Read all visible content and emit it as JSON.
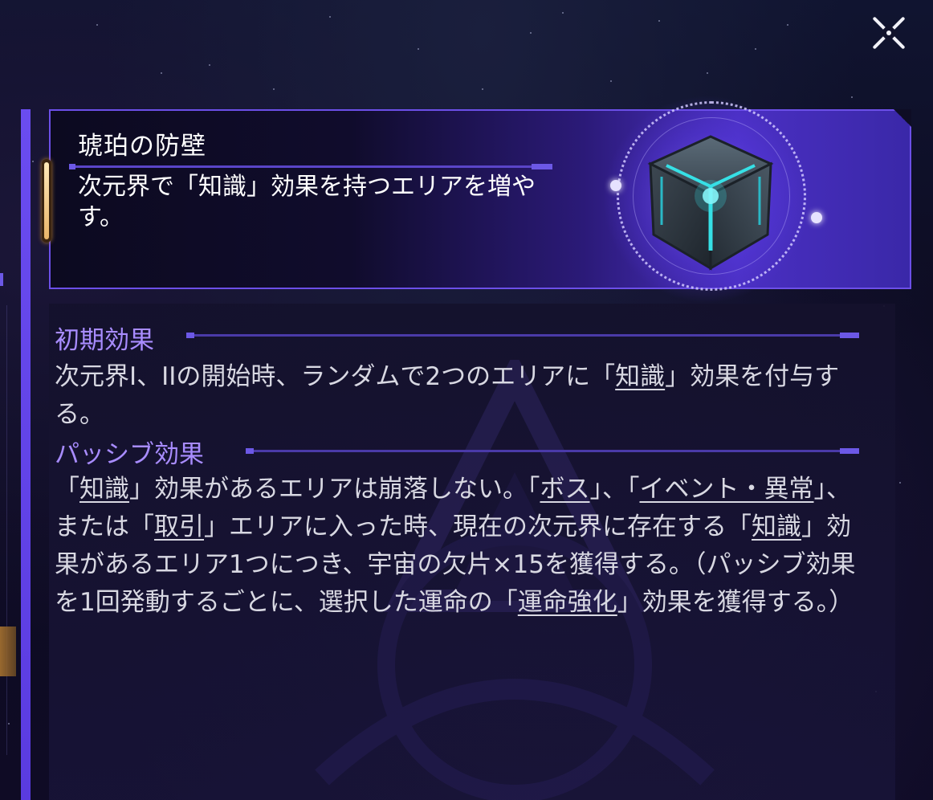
{
  "relic": {
    "name": "琥珀の防壁",
    "description": "次元界で「知識」効果を持つエリアを増やす。",
    "icon": "cube-relic-icon",
    "accent_color": "#6c4fe8",
    "glow_color": "#36e0e6"
  },
  "close_button": {
    "icon": "close-icon"
  },
  "sections": [
    {
      "title": "初期効果",
      "segments": [
        {
          "text": "次元界I、IIの開始時、ランダムで2つのエリアに「"
        },
        {
          "text": "知識",
          "keyword": true
        },
        {
          "text": "」効果を付与する。"
        }
      ]
    },
    {
      "title": "パッシブ効果",
      "segments": [
        {
          "text": "「"
        },
        {
          "text": "知識",
          "keyword": true
        },
        {
          "text": "」効果があるエリアは崩落しない。「"
        },
        {
          "text": "ボス",
          "keyword": true
        },
        {
          "text": "」、「"
        },
        {
          "text": "イベント・異常",
          "keyword": true
        },
        {
          "text": "」、または「"
        },
        {
          "text": "取引",
          "keyword": true
        },
        {
          "text": "」エリアに入った時、現在の次元界に存在する「"
        },
        {
          "text": "知識",
          "keyword": true
        },
        {
          "text": "」効果があるエリア1つにつき、宇宙の欠片×15を獲得する。（パッシブ効果を1回発動するごとに、選択した運命の「"
        },
        {
          "text": "運命強化",
          "keyword": true
        },
        {
          "text": "」効果を獲得する。）"
        }
      ]
    }
  ],
  "colors": {
    "section_title": "#a88cff",
    "body_text": "#d8d8e2",
    "panel_border": "#6c4fe8"
  }
}
